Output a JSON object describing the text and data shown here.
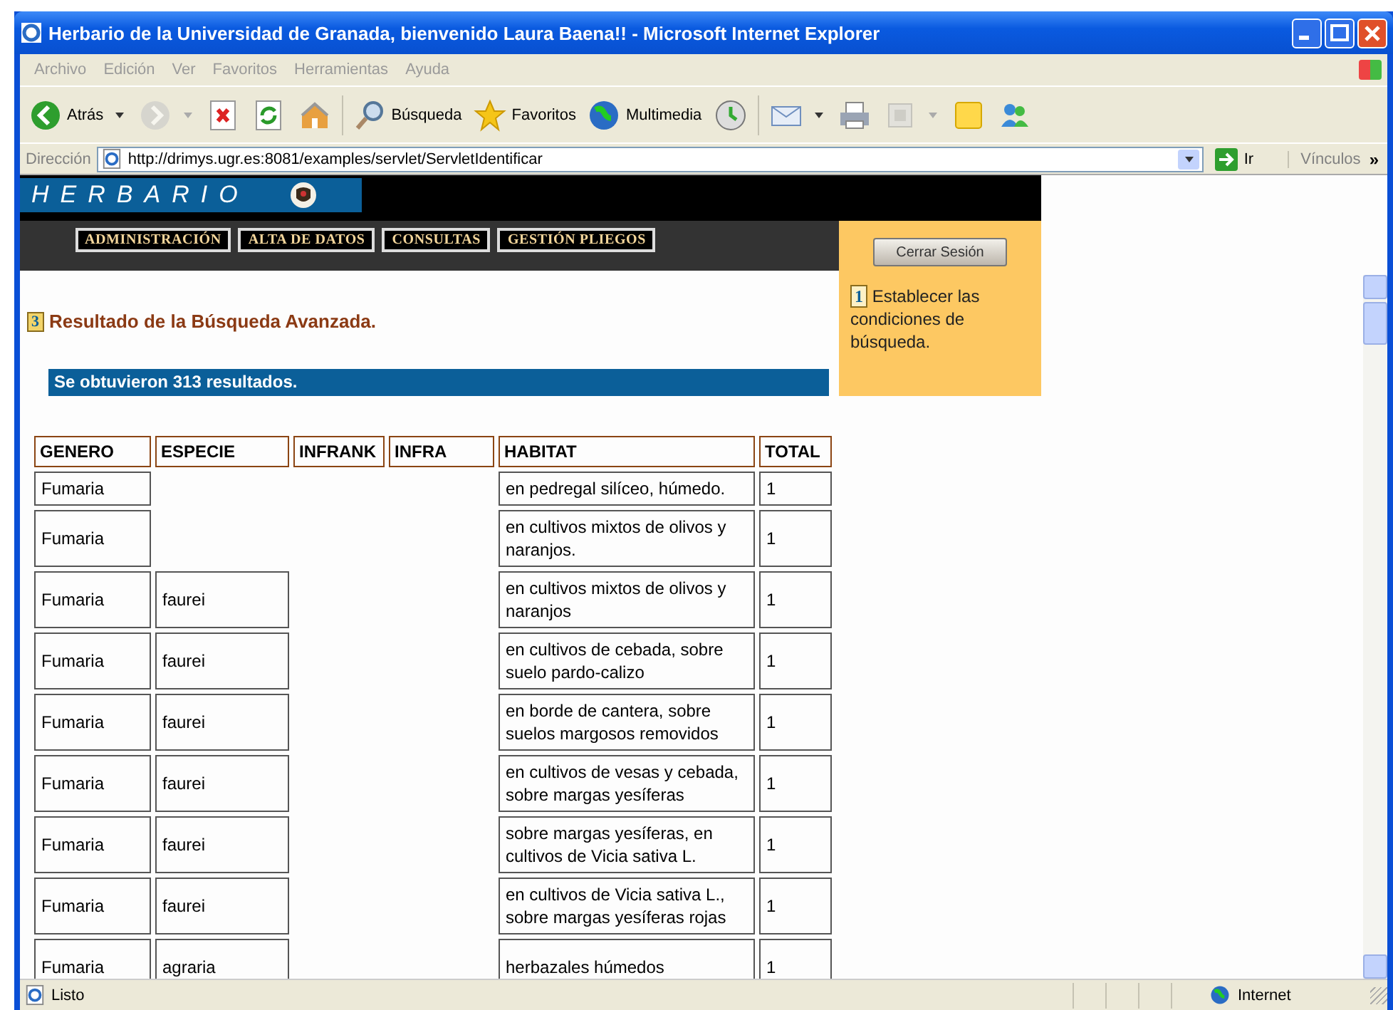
{
  "window": {
    "title": "Herbario de la Universidad de Granada, bienvenido Laura Baena!! - Microsoft Internet Explorer"
  },
  "menu": [
    "Archivo",
    "Edición",
    "Ver",
    "Favoritos",
    "Herramientas",
    "Ayuda"
  ],
  "toolbar": [
    {
      "kind": "button",
      "label": "Atrás",
      "dropdown": true,
      "disabled": false
    },
    {
      "kind": "button",
      "dropdown": true,
      "disabled": true
    },
    {
      "kind": "button",
      "dropdown": false,
      "disabled": false
    },
    {
      "kind": "button",
      "dropdown": false,
      "disabled": false
    },
    {
      "kind": "button",
      "dropdown": false,
      "disabled": false
    },
    {
      "kind": "separator"
    },
    {
      "kind": "button",
      "label": "Búsqueda",
      "dropdown": false,
      "disabled": false
    },
    {
      "kind": "button",
      "label": "Favoritos",
      "dropdown": false,
      "disabled": false
    },
    {
      "kind": "button",
      "label": "Multimedia",
      "dropdown": false,
      "disabled": false
    },
    {
      "kind": "button",
      "dropdown": false,
      "disabled": false
    },
    {
      "kind": "separator"
    },
    {
      "kind": "button",
      "dropdown": true,
      "disabled": false
    },
    {
      "kind": "button",
      "dropdown": false,
      "disabled": false
    },
    {
      "kind": "button",
      "dropdown": true,
      "disabled": true
    },
    {
      "kind": "button",
      "dropdown": false,
      "disabled": false
    },
    {
      "kind": "button",
      "dropdown": false,
      "disabled": false
    }
  ],
  "address": {
    "label": "Dirección",
    "url": "http://drimys.ugr.es:8081/examples/servlet/ServletIdentificar",
    "go": "Ir",
    "links": "Vínculos",
    "more": "»"
  },
  "page": {
    "logo": "HERBARIO",
    "nav": [
      "ADMINISTRACIÓN",
      "ALTA DE DATOS",
      "CONSULTAS",
      "GESTIÓN PLIEGOS"
    ],
    "logout": "Cerrar Sesión",
    "step": {
      "number": "1",
      "text": "Establecer las condiciones de búsqueda."
    },
    "heading": {
      "number": "3",
      "text": "Resultado de la Búsqueda Avanzada."
    },
    "result": "Se obtuvieron 313 resultados.",
    "table": {
      "columns": [
        "GENERO",
        "ESPECIE",
        "INFRANK",
        "INFRA",
        "HABITAT",
        "TOTAL"
      ],
      "rows": [
        [
          "Fumaria",
          null,
          null,
          null,
          "en pedregal silíceo, húmedo.",
          "1"
        ],
        [
          "Fumaria",
          null,
          null,
          null,
          "en cultivos mixtos de olivos y naranjos.",
          "1"
        ],
        [
          "Fumaria",
          "faurei",
          null,
          null,
          "en cultivos mixtos de olivos y naranjos",
          "1"
        ],
        [
          "Fumaria",
          "faurei",
          null,
          null,
          "en cultivos de cebada, sobre suelo pardo-calizo",
          "1"
        ],
        [
          "Fumaria",
          "faurei",
          null,
          null,
          "en borde de cantera, sobre suelos margosos removidos",
          "1"
        ],
        [
          "Fumaria",
          "faurei",
          null,
          null,
          "en cultivos de vesas y cebada, sobre margas yesíferas",
          "1"
        ],
        [
          "Fumaria",
          "faurei",
          null,
          null,
          "sobre margas yesíferas, en cultivos de Vicia sativa L.",
          "1"
        ],
        [
          "Fumaria",
          "faurei",
          null,
          null,
          "en cultivos de Vicia sativa L., sobre margas yesíferas rojas",
          "1"
        ],
        [
          "Fumaria",
          "agraria",
          null,
          null,
          "herbazales húmedos",
          "1"
        ]
      ]
    }
  },
  "status_bar": {
    "text": "Listo",
    "zone": "Internet"
  }
}
